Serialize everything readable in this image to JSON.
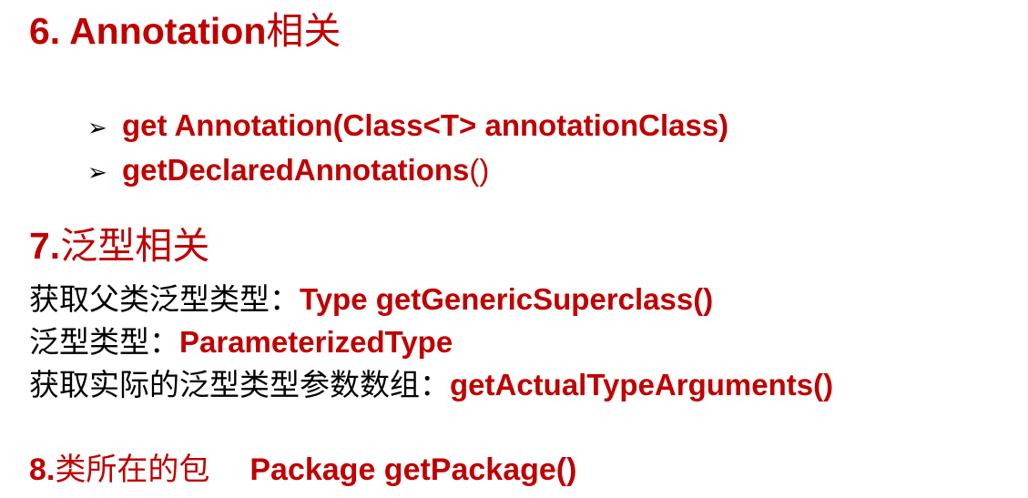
{
  "section6": {
    "title_num": "6. Annotation",
    "title_cjk": "相关",
    "bullets": [
      {
        "marker": "➢",
        "text": "get Annotation(Class<T> annotationClass)"
      },
      {
        "marker": "➢",
        "text_bold": "getDeclaredAnnotations",
        "text_plain": "()"
      }
    ]
  },
  "section7": {
    "title_num": "7.",
    "title_cjk": "泛型相关",
    "lines": [
      {
        "label": "获取父类泛型类型：",
        "value": "Type getGenericSuperclass()"
      },
      {
        "label": "泛型类型：",
        "value": "ParameterizedType"
      },
      {
        "label": "获取实际的泛型类型参数数组：",
        "value": "getActualTypeArguments()"
      }
    ]
  },
  "section8": {
    "title_num": "8.",
    "title_cjk": "类所在的包",
    "value": "Package getPackage()"
  }
}
